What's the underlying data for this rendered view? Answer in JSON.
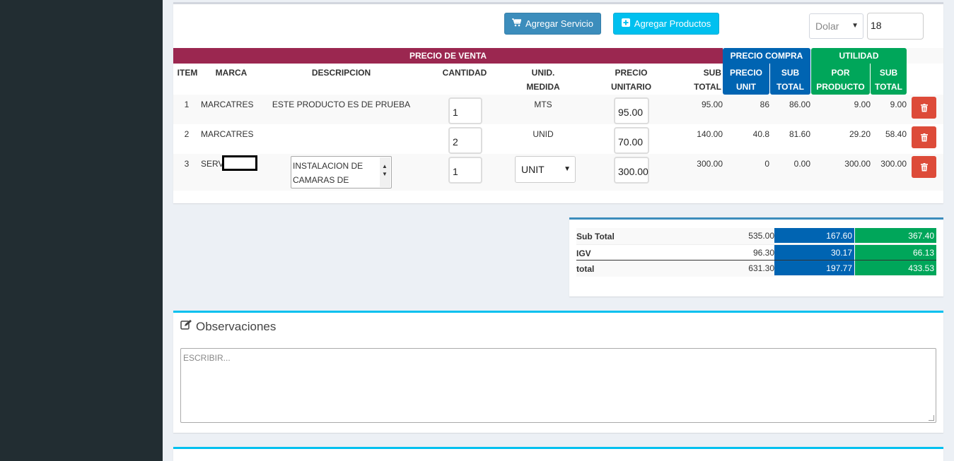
{
  "toolbar": {
    "add_service_label": "Agregar Servicio",
    "add_products_label": "Agregar Productos",
    "currency_value": "Dolar",
    "exchange_rate": "18"
  },
  "table": {
    "bands": {
      "venta": "PRECIO DE VENTA",
      "compra": "PRECIO COMPRA",
      "utilidad": "UTILIDAD"
    },
    "headers": {
      "item": "ITEM",
      "marca": "MARCA",
      "descripcion": "DESCRIPCION",
      "cantidad": "CANTIDAD",
      "unid1": "UNID.",
      "unid2": "MEDIDA",
      "precio1": "PRECIO",
      "precio2": "UNITARIO",
      "sub1": "SUB",
      "sub2": "TOTAL",
      "pcu1": "PRECIO",
      "pcu2": "UNIT",
      "pcs1": "SUB",
      "pcs2": "TOTAL",
      "up1": "POR",
      "up2": "PRODUCTO",
      "us1": "SUB",
      "us2": "TOTAL"
    },
    "rows": [
      {
        "item": "1",
        "marca": "MARCATRES",
        "descripcion": "ESTE PRODUCTO ES DE PRUEBA",
        "cantidad": "1",
        "unidad": "MTS",
        "precio_unitario": "95.00",
        "sub_total": "95.00",
        "compra_unit": "86",
        "compra_sub": "86.00",
        "util_producto": "9.00",
        "util_sub": "9.00"
      },
      {
        "item": "2",
        "marca": "MARCATRES",
        "descripcion": "",
        "cantidad": "2",
        "unidad": "UNID",
        "precio_unitario": "70.00",
        "sub_total": "140.00",
        "compra_unit": "40.8",
        "compra_sub": "81.60",
        "util_producto": "29.20",
        "util_sub": "58.40"
      },
      {
        "item": "3",
        "marca": "SERV",
        "descripcion": "INSTALACION DE CAMARAS DE",
        "cantidad": "1",
        "unidad": "UNIT",
        "precio_unitario": "300.00",
        "sub_total": "300.00",
        "compra_unit": "0",
        "compra_sub": "0.00",
        "util_producto": "300.00",
        "util_sub": "300.00"
      }
    ]
  },
  "totals": {
    "rows": [
      {
        "label": "Sub Total",
        "venta": "535.00",
        "compra": "167.60",
        "utilidad": "367.40"
      },
      {
        "label": "IGV",
        "venta": "96.30",
        "compra": "30.17",
        "utilidad": "66.13"
      },
      {
        "label": "total",
        "venta": "631.30",
        "compra": "197.77",
        "utilidad": "433.53"
      }
    ]
  },
  "observaciones": {
    "title": "Observaciones",
    "placeholder": "ESCRIBIR..."
  },
  "colors": {
    "venta_band": "#9b2750",
    "compra_band": "#0064b2",
    "utilidad_band": "#00a65a",
    "delete_button": "#dd4b39",
    "primary_button": "#3c8dbc",
    "info_button": "#00c0ef"
  }
}
